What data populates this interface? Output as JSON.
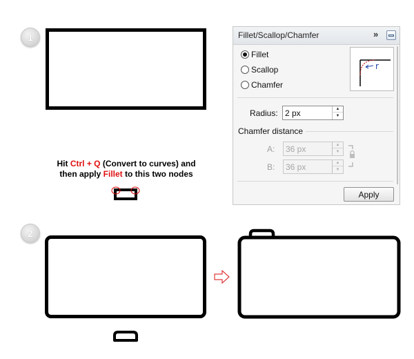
{
  "steps": {
    "one": "1",
    "two": "2"
  },
  "instruction": {
    "part1": "Hit ",
    "shortcut": "Ctrl + Q",
    "part2": " (Convert to curves) and",
    "part3": "then apply ",
    "fillet": "Fillet",
    "part4": " to this two nodes"
  },
  "panel": {
    "title": "Fillet/Scallop/Chamfer",
    "expand_glyph": "»",
    "options": [
      {
        "label": "Fillet",
        "selected": true
      },
      {
        "label": "Scallop",
        "selected": false
      },
      {
        "label": "Chamfer",
        "selected": false
      }
    ],
    "preview_label": "r",
    "radius": {
      "label": "Radius:",
      "value": "2 px"
    },
    "chamfer_section": "Chamfer distance",
    "chamfer_a": {
      "label": "A:",
      "value": "36 px"
    },
    "chamfer_b": {
      "label": "B:",
      "value": "36 px"
    },
    "apply_label": "Apply",
    "up_glyph": "▲",
    "down_glyph": "▼"
  },
  "colors": {
    "accent_red": "#e01010",
    "preview_curve": "#cc2222",
    "preview_arrow": "#2244aa",
    "arrow_outline": "#e03a3a"
  },
  "icons": {
    "arrow": "right-arrow-icon",
    "lock": "lock-icon"
  }
}
